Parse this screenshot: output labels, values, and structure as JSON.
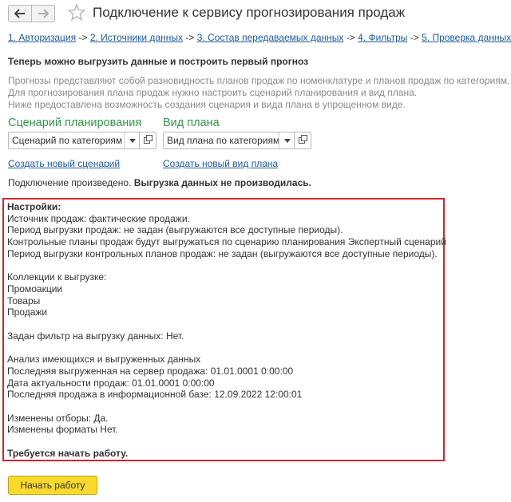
{
  "window": {
    "title": "Подключение к сервису прогнозирования продаж"
  },
  "breadcrumbs": [
    {
      "label": "1. Авторизация"
    },
    {
      "label": "2. Источники данных"
    },
    {
      "label": "3. Состав передаваемых данных"
    },
    {
      "label": "4. Фильтры"
    },
    {
      "label": "5. Проверка данных"
    }
  ],
  "breadcrumb_separator": "->",
  "heading": "Теперь можно выгрузить данные и построить первый прогноз",
  "info_lines": [
    "Прогнозы представляют собой разновидность планов продаж по номенклатуре и планов продаж по категориям.",
    "Для прогнозирования плана продаж нужно настроить сценарий планирования и вид плана.",
    "Ниже предоставлена возможность создания сценария и вида плана в упрощенном виде."
  ],
  "scenario": {
    "label": "Сценарий планирования",
    "value": "Сценарий по категориям",
    "create_link": "Создать новый сценарий"
  },
  "plan_type": {
    "label": "Вид плана",
    "value": "Вид плана по категориям",
    "create_link": "Создать новый вид плана"
  },
  "status": {
    "connection": "Подключение произведено.",
    "upload": "Выгрузка данных не производилась."
  },
  "settings": {
    "title": "Настройки:",
    "lines": [
      "Источник продаж: фактические продажи.",
      "Период выгрузки продаж: не задан (выгружаются все доступные периоды).",
      "Контрольные планы продаж будут выгружаться по сценарию планирования Экспертный сценарий",
      "Период выгрузки контрольных планов продаж: не задан (выгружаются все доступные периоды).",
      "",
      "Коллекции к выгрузке:",
      "Промоакции",
      "Товары",
      "Продажи",
      "",
      "Задан фильтр на выгрузку данных: Нет.",
      "",
      "Анализ имеющихся и выгруженных данных",
      "Последняя выгруженная на сервер продажа: 01.01.0001 0:00:00",
      "Дата актуальности продаж: 01.01.0001 0:00:00",
      "Последняя продажа в информационной базе: 12.09.2022 12:00:01",
      "",
      "Изменены отборы: Да.",
      "Изменены форматы Нет.",
      ""
    ],
    "footer": "Требуется начать работу."
  },
  "start_button": "Начать работу",
  "colors": {
    "link": "#1c5aa6",
    "label_green": "#2f9b44",
    "highlight_border": "#d9232a",
    "button_yellow": "#f9d92c"
  }
}
